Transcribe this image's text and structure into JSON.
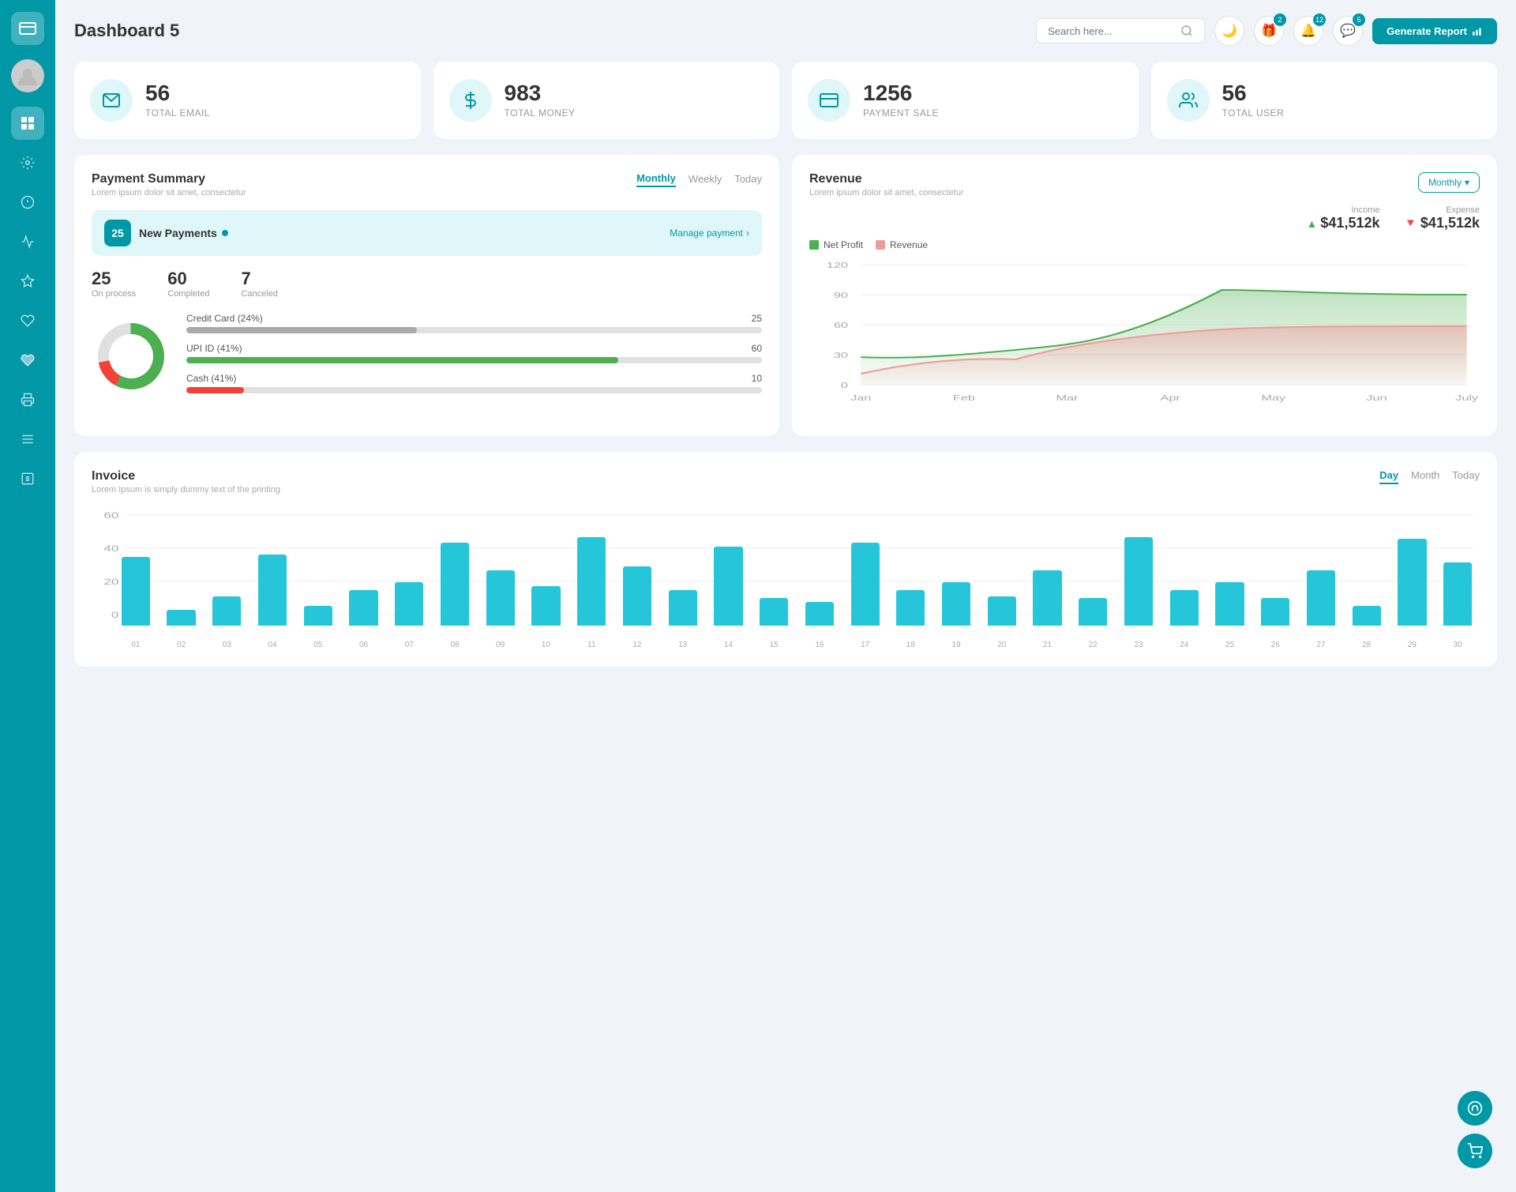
{
  "sidebar": {
    "logo_icon": "💳",
    "nav_items": [
      {
        "id": "avatar",
        "icon": "👤",
        "active": false
      },
      {
        "id": "dashboard",
        "icon": "⊞",
        "active": true
      },
      {
        "id": "settings",
        "icon": "⚙",
        "active": false
      },
      {
        "id": "info",
        "icon": "ℹ",
        "active": false
      },
      {
        "id": "analytics",
        "icon": "📊",
        "active": false
      },
      {
        "id": "star",
        "icon": "★",
        "active": false
      },
      {
        "id": "heart1",
        "icon": "♥",
        "active": false
      },
      {
        "id": "heart2",
        "icon": "♥",
        "active": false
      },
      {
        "id": "print",
        "icon": "🖨",
        "active": false
      },
      {
        "id": "menu",
        "icon": "≡",
        "active": false
      },
      {
        "id": "list",
        "icon": "📋",
        "active": false
      }
    ]
  },
  "header": {
    "title": "Dashboard 5",
    "search_placeholder": "Search here...",
    "icons": [
      {
        "id": "dark-mode",
        "icon": "🌙",
        "badge": null
      },
      {
        "id": "gift",
        "icon": "🎁",
        "badge": "2"
      },
      {
        "id": "bell",
        "icon": "🔔",
        "badge": "12"
      },
      {
        "id": "chat",
        "icon": "💬",
        "badge": "5"
      }
    ],
    "generate_btn": "Generate Report"
  },
  "stat_cards": [
    {
      "id": "total-email",
      "icon": "📋",
      "number": "56",
      "label": "TOTAL EMAIL"
    },
    {
      "id": "total-money",
      "icon": "$",
      "number": "983",
      "label": "TOTAL MONEY"
    },
    {
      "id": "payment-sale",
      "icon": "💳",
      "number": "1256",
      "label": "PAYMENT SALE"
    },
    {
      "id": "total-user",
      "icon": "👥",
      "number": "56",
      "label": "TOTAL USER"
    }
  ],
  "payment_summary": {
    "title": "Payment Summary",
    "subtitle": "Lorem ipsum dolor sit amet, consectetur",
    "tabs": [
      "Monthly",
      "Weekly",
      "Today"
    ],
    "active_tab": "Monthly",
    "new_payments_count": "25",
    "new_payments_label": "New Payments",
    "manage_payment": "Manage payment",
    "stats": [
      {
        "number": "25",
        "label": "On process"
      },
      {
        "number": "60",
        "label": "Completed"
      },
      {
        "number": "7",
        "label": "Canceled"
      }
    ],
    "progress_items": [
      {
        "label": "Credit Card (24%)",
        "value": 25,
        "percent": 40,
        "color": "#aaa"
      },
      {
        "label": "UPI ID (41%)",
        "value": 60,
        "percent": 75,
        "color": "#4caf50"
      },
      {
        "label": "Cash (41%)",
        "value": 10,
        "percent": 10,
        "color": "#f44336"
      }
    ],
    "donut": {
      "segments": [
        {
          "color": "#4caf50",
          "percent": 58
        },
        {
          "color": "#f44336",
          "percent": 14
        },
        {
          "color": "#e0e0e0",
          "percent": 28
        }
      ]
    }
  },
  "revenue": {
    "title": "Revenue",
    "subtitle": "Lorem ipsum dolor sit amet, consectetur",
    "tab": "Monthly",
    "income": {
      "label": "Income",
      "amount": "$41,512k"
    },
    "expense": {
      "label": "Expense",
      "amount": "$41,512k"
    },
    "legend": [
      {
        "label": "Net Profit",
        "color": "#81c784"
      },
      {
        "label": "Revenue",
        "color": "#ef9a9a"
      }
    ],
    "chart": {
      "x_labels": [
        "Jan",
        "Feb",
        "Mar",
        "Apr",
        "May",
        "Jun",
        "July"
      ],
      "y_labels": [
        "0",
        "30",
        "60",
        "90",
        "120"
      ],
      "net_profit_data": [
        28,
        25,
        30,
        35,
        40,
        95,
        90
      ],
      "revenue_data": [
        10,
        22,
        28,
        25,
        40,
        55,
        58
      ]
    }
  },
  "invoice": {
    "title": "Invoice",
    "subtitle": "Lorem Ipsum is simply dummy text of the printing",
    "tabs": [
      "Day",
      "Month",
      "Today"
    ],
    "active_tab": "Day",
    "y_labels": [
      "0",
      "20",
      "40",
      "60"
    ],
    "x_labels": [
      "01",
      "02",
      "03",
      "04",
      "05",
      "06",
      "07",
      "08",
      "09",
      "10",
      "11",
      "12",
      "13",
      "14",
      "15",
      "16",
      "17",
      "18",
      "19",
      "20",
      "21",
      "22",
      "23",
      "24",
      "25",
      "26",
      "27",
      "28",
      "29",
      "30"
    ],
    "bar_data": [
      35,
      8,
      15,
      36,
      10,
      18,
      22,
      42,
      28,
      20,
      45,
      30,
      18,
      40,
      14,
      12,
      42,
      18,
      22,
      15,
      28,
      14,
      45,
      18,
      22,
      14,
      28,
      10,
      44,
      32
    ]
  },
  "colors": {
    "primary": "#0097a7",
    "accent": "#e0f7fa",
    "green": "#4caf50",
    "red": "#f44336",
    "bar": "#26c6da"
  }
}
